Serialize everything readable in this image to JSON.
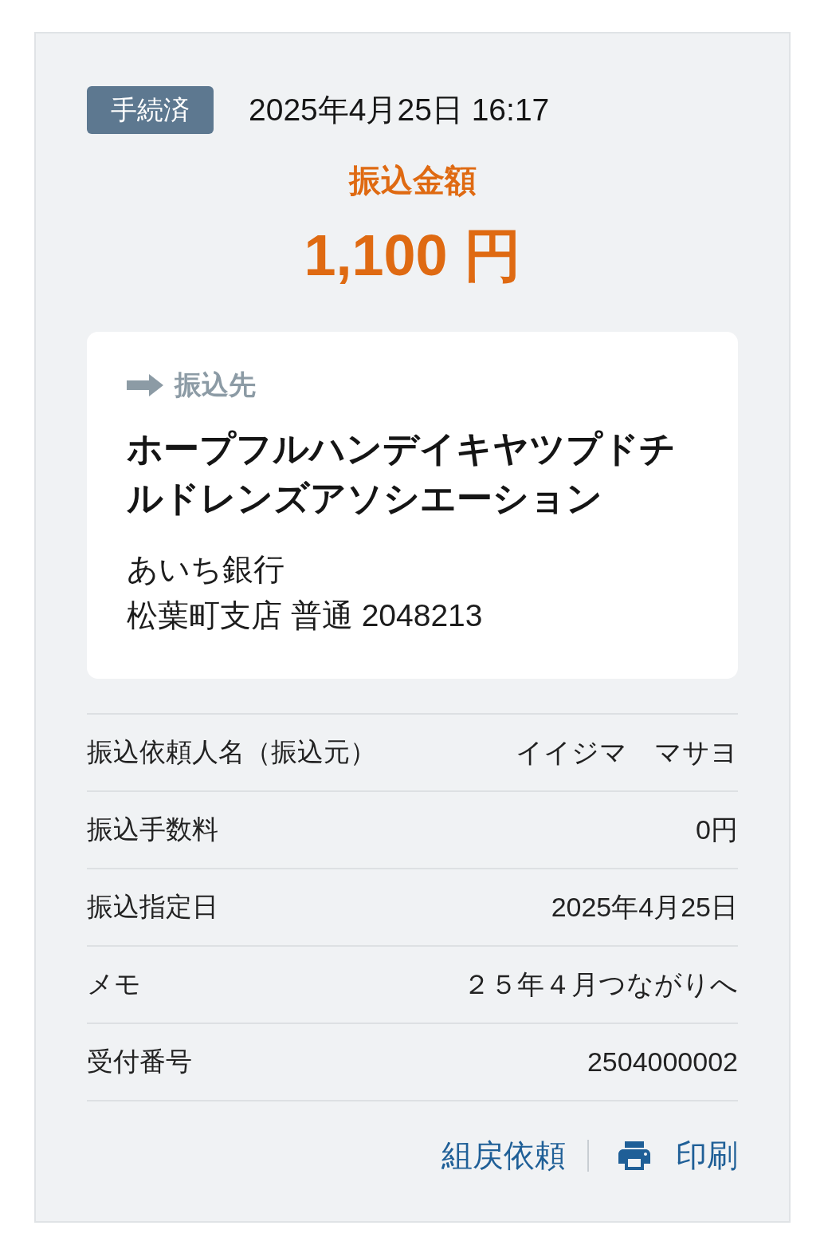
{
  "status_badge": "手続済",
  "datetime": "2025年4月25日 16:17",
  "amount": {
    "label": "振込金額",
    "value": "1,100 円"
  },
  "recipient": {
    "heading": "振込先",
    "name": "ホープフルハンデイキヤツプドチルドレンズアソシエーション",
    "bank": "あいち銀行",
    "branch_account": "松葉町支店 普通 2048213"
  },
  "details": [
    {
      "label": "振込依頼人名（振込元）",
      "value": "イイジマ　マサヨ"
    },
    {
      "label": "振込手数料",
      "value": "0円"
    },
    {
      "label": "振込指定日",
      "value": "2025年4月25日"
    },
    {
      "label": "メモ",
      "value": "２５年４月つながりへ"
    },
    {
      "label": "受付番号",
      "value": "2504000002"
    }
  ],
  "actions": [
    {
      "kind": "link",
      "label": "組戻依頼"
    },
    {
      "kind": "print",
      "label": "印刷"
    }
  ]
}
